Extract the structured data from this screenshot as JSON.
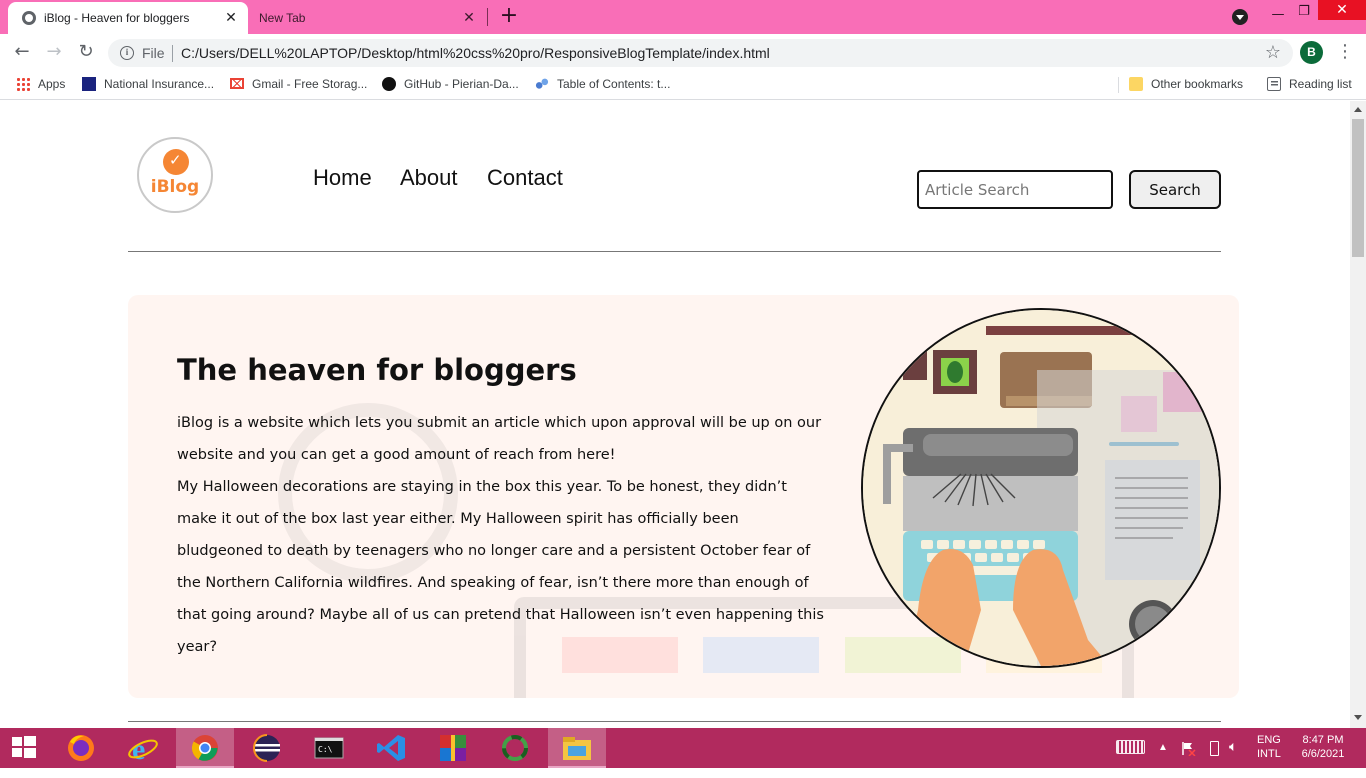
{
  "browser": {
    "tabs": [
      {
        "title": "iBlog - Heaven for bloggers",
        "active": true
      },
      {
        "title": "New Tab",
        "active": false
      }
    ],
    "new_tab_icon": "+",
    "close_icon": "✕",
    "window_controls": {
      "minimize": "—",
      "restore": "❐",
      "close": "✕"
    },
    "nav": {
      "back": "←",
      "forward": "→",
      "reload": "↻"
    },
    "omnibox": {
      "scheme": "File",
      "url": "C:/Users/DELL%20LAPTOP/Desktop/html%20css%20pro/ResponsiveBlogTemplate/index.html"
    },
    "star_icon": "☆",
    "profile_initial": "B",
    "menu_icon": "⋮",
    "bookmarks": [
      {
        "label": "Apps",
        "icon": "apps-grid-icon"
      },
      {
        "label": "National Insurance...",
        "icon": "national-insurance-icon"
      },
      {
        "label": "Gmail - Free Storag...",
        "icon": "gmail-icon"
      },
      {
        "label": "GitHub - Pierian-Da...",
        "icon": "github-icon"
      },
      {
        "label": "Table of Contents: t...",
        "icon": "table-of-contents-icon"
      }
    ],
    "other_bookmarks": "Other bookmarks",
    "reading_list": "Reading list"
  },
  "site": {
    "logo_text": "iBlog",
    "nav": [
      "Home",
      "About",
      "Contact"
    ],
    "search": {
      "placeholder": "Article Search",
      "button": "Search"
    },
    "hero": {
      "title": "The heaven for bloggers",
      "paragraph1": "iBlog is a website which lets you submit an article which upon approval will be up on our website and you can get a good amount of reach from here!",
      "paragraph2": "My Halloween decorations are staying in the box this year. To be honest, they didn’t make it out of the box last year either. My Halloween spirit has officially been bludgeoned to death by teenagers who no longer care and a persistent October fear of the Northern California wildfires. And speaking of fear, isn’t there more than enough of that going around? Maybe all of us can pretend that Halloween isn’t even happening this year?"
    }
  },
  "taskbar": {
    "apps": [
      "start-icon",
      "firefox-icon",
      "internet-explorer-icon",
      "chrome-icon",
      "eclipse-icon",
      "terminal-icon",
      "vscode-icon",
      "winrar-icon",
      "refresh-app-icon",
      "file-explorer-icon"
    ],
    "lang_top": "ENG",
    "lang_bottom": "INTL",
    "time": "8:47 PM",
    "date": "6/6/2021"
  },
  "colors": {
    "tabbar": "#f96eb7",
    "taskbar": "#b12a5e",
    "hero_bg": "#fff5f1",
    "logo_orange": "#f58634"
  }
}
